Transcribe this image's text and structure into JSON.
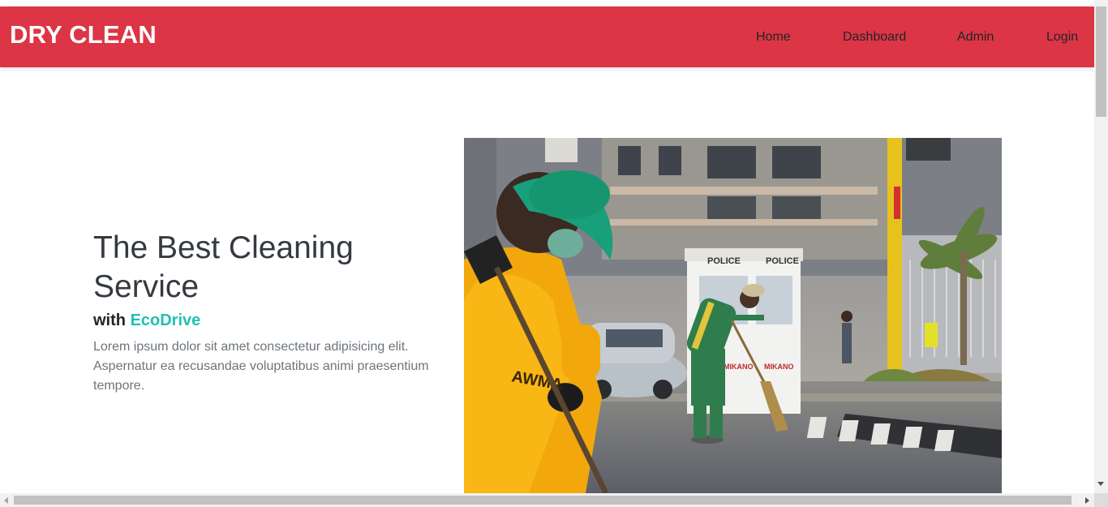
{
  "navbar": {
    "brand": "DRY CLEAN",
    "background_color": "#dc3545",
    "links": [
      {
        "label": "Home"
      },
      {
        "label": "Dashboard"
      },
      {
        "label": "Admin"
      },
      {
        "label": "Login"
      }
    ]
  },
  "hero": {
    "title": "The Best Cleaning Service",
    "subtitle_prefix": "with",
    "subtitle_accent": "EcoDrive",
    "accent_color": "#20c0b0",
    "description": "Lorem ipsum dolor sit amet consectetur adipisicing elit. Aspernatur ea recusandae voluptatibus animi praesentium tempore.",
    "image": {
      "subject": "street cleaners sweeping a road",
      "booth_sign_1": "POLICE",
      "booth_sign_2": "POLICE",
      "booth_brand_1": "MIKANO",
      "booth_brand_2": "MIKANO",
      "uniform_text": "AWMA"
    }
  }
}
